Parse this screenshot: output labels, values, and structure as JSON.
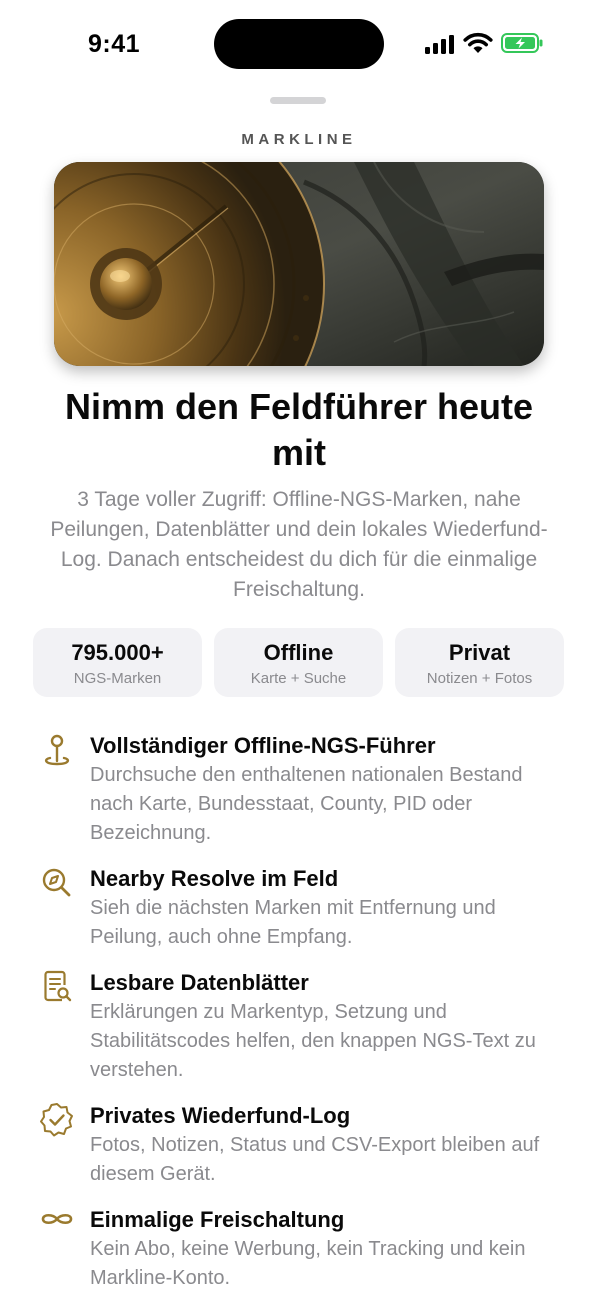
{
  "status_bar": {
    "time": "9:41"
  },
  "brand": "MARKLINE",
  "headline": "Nimm den Feldführer heute mit",
  "subtitle": "3 Tage voller Zugriff: Offline-NGS-Marken, nahe Peilungen, Datenblätter und dein lokales Wiederfund-Log. Danach entscheidest du dich für die einmalige Freischaltung.",
  "stats": [
    {
      "value": "795.000+",
      "label": "NGS-Marken"
    },
    {
      "value": "Offline",
      "label": "Karte + Suche"
    },
    {
      "value": "Privat",
      "label": "Notizen + Fotos"
    }
  ],
  "features": [
    {
      "icon": "map-pin-icon",
      "title": "Vollständiger Offline-NGS-Führer",
      "desc": "Durchsuche den enthaltenen nationalen Bestand nach Karte, Bundesstaat, County, PID oder Bezeichnung."
    },
    {
      "icon": "compass-search-icon",
      "title": "Nearby Resolve im Feld",
      "desc": "Sieh die nächsten Marken mit Entfernung und Peilung, auch ohne Empfang."
    },
    {
      "icon": "datasheet-icon",
      "title": "Lesbare Datenblätter",
      "desc": "Erklärungen zu Markentyp, Setzung und Stabilitätscodes helfen, den knappen NGS-Text zu verstehen."
    },
    {
      "icon": "verified-badge-icon",
      "title": "Privates Wiederfund-Log",
      "desc": "Fotos, Notizen, Status und CSV-Export bleiben auf diesem Gerät."
    },
    {
      "icon": "infinity-icon",
      "title": "Einmalige Freischaltung",
      "desc": "Kein Abo, keine Werbung, kein Tracking und kein Markline-Konto."
    }
  ],
  "colors": {
    "accent": "#9a7a2e",
    "battery": "#34c759",
    "muted": "#8a8a8e",
    "card": "#f2f2f5"
  }
}
